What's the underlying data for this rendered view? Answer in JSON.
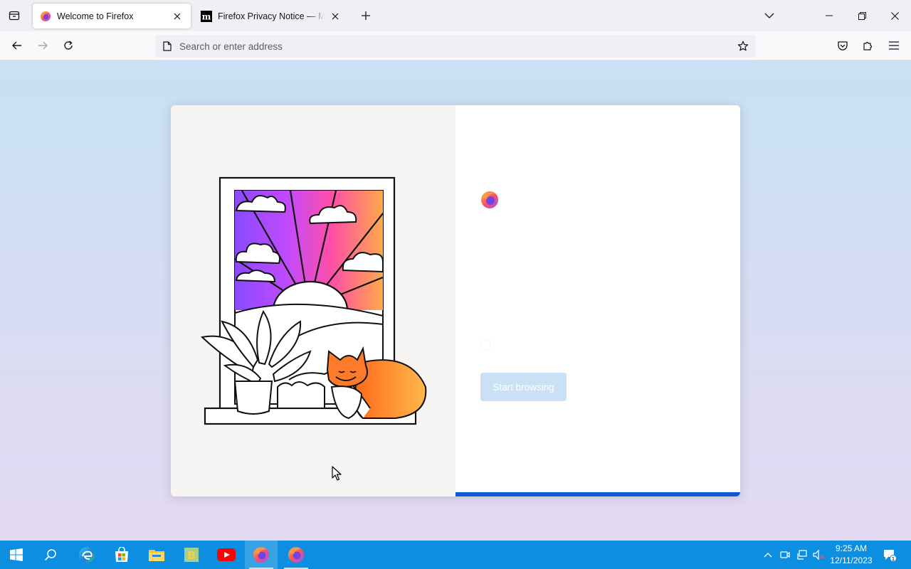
{
  "browser": {
    "tabs": [
      {
        "title": "Welcome to Firefox",
        "active": true,
        "favicon": "firefox-icon"
      },
      {
        "title": "Firefox Privacy Notice — Mozilla",
        "active": false,
        "favicon": "mozilla-m-icon"
      }
    ],
    "address_placeholder": "Search or enter address"
  },
  "welcome": {
    "headline": "",
    "subtitle": "",
    "checkbox_label": "",
    "start_button_label": "Start browsing",
    "progress_fraction": 0.5
  },
  "taskbar": {
    "apps": [
      "start-windows-icon",
      "search-icon",
      "edge-icon",
      "microsoft-store-icon",
      "file-explorer-icon",
      "bing-icon",
      "youtube-icon",
      "firefox-icon",
      "firefox-icon"
    ],
    "time": "9:25 AM",
    "date": "12/11/2023",
    "notification_count": "1"
  },
  "colors": {
    "accent": "#0a5bd4",
    "taskbar": "#0c8fe0",
    "button_disabled": "#c9e0f7"
  }
}
